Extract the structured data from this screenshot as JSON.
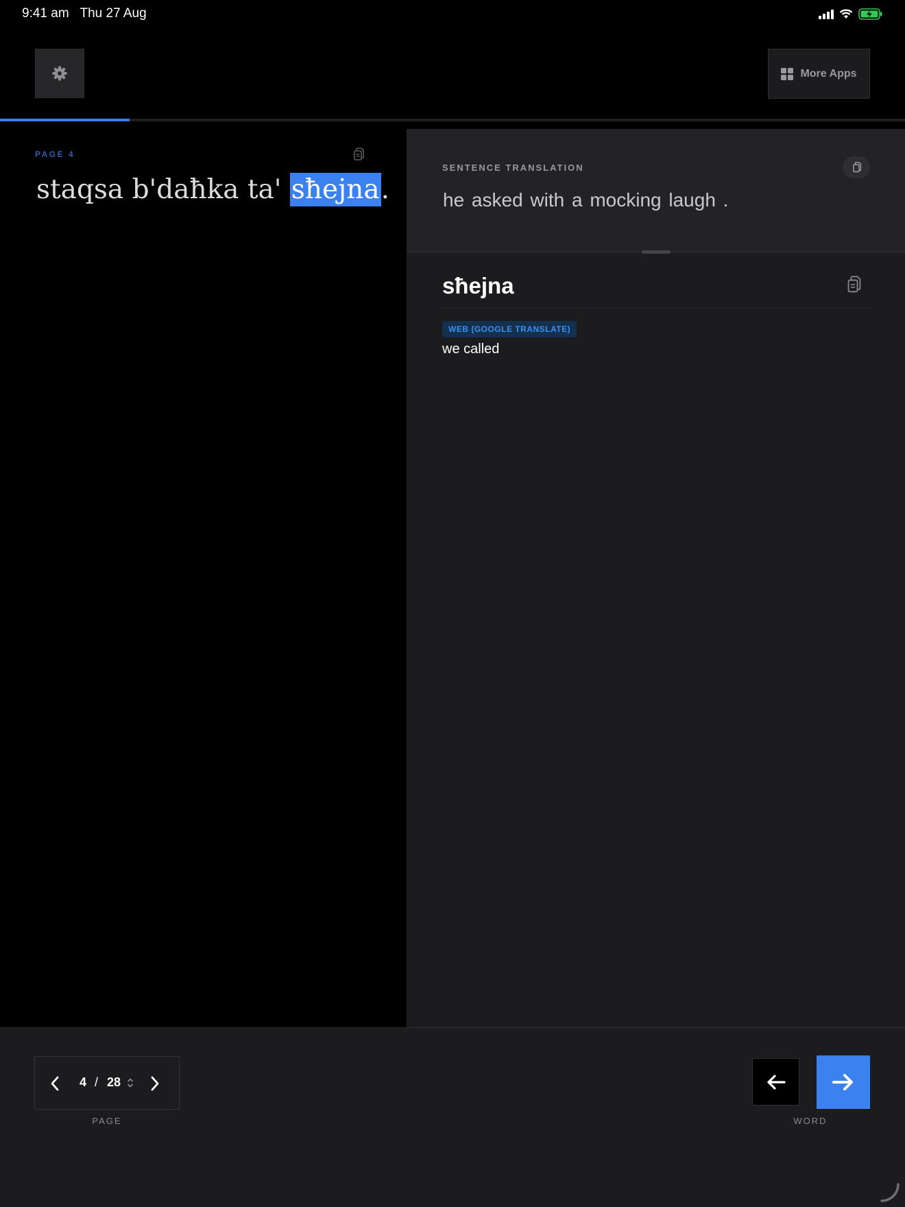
{
  "status_bar": {
    "time": "9:41 am",
    "date": "Thu 27 Aug",
    "icons": [
      "cellular-signal-icon",
      "wifi-icon",
      "battery-charging-icon"
    ]
  },
  "toolbar": {
    "settings_icon": "gear-icon",
    "more_apps_label": "More Apps",
    "more_apps_icon": "grid-icon"
  },
  "progress": {
    "fraction": 0.1429
  },
  "reader": {
    "page_label": "PAGE 4",
    "sentence_before": "staqsa b'daħka ta' ",
    "highlighted_word": "sħejna",
    "sentence_after": "."
  },
  "translation": {
    "section_label": "SENTENCE TRANSLATION",
    "text": "he asked with a mocking laugh ."
  },
  "word_detail": {
    "word": "sħejna",
    "source_badge": "WEB (GOOGLE TRANSLATE)",
    "definition": "we called"
  },
  "pager": {
    "current": "4",
    "separator": "/",
    "total": "28",
    "caption": "PAGE"
  },
  "word_nav": {
    "caption": "WORD",
    "prev_icon": "arrow-left-icon",
    "next_icon": "arrow-right-icon"
  },
  "colors": {
    "accent": "#3b82f0",
    "background": "#000000",
    "panel": "#1c1c1e",
    "battery": "#34c759"
  }
}
